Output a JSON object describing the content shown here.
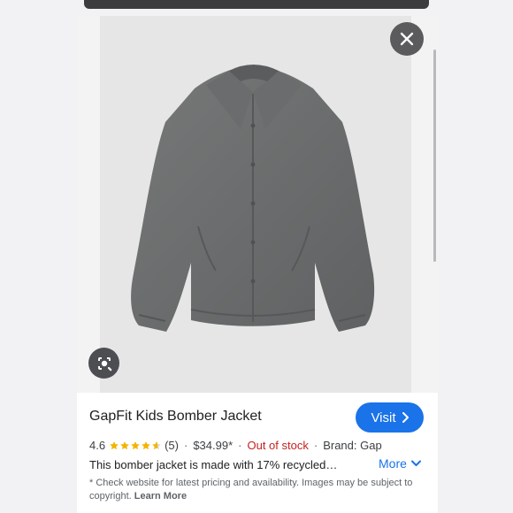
{
  "product": {
    "title": "GapFit Kids Bomber Jacket",
    "rating": "4.6",
    "stars": 4.6,
    "review_count": "(5)",
    "price": "$34.99*",
    "availability": "Out of stock",
    "brand": "Brand: Gap",
    "description": "This bomber jacket is made with 17% recycled…"
  },
  "actions": {
    "visit_label": "Visit",
    "more_label": "More"
  },
  "disclaimer": {
    "text": "* Check website for latest pricing and availability. Images may be subject to copyright.",
    "learn_more": "Learn More"
  },
  "icons": {
    "close": "close-icon",
    "lens": "lens-search-icon",
    "visit_arrow": "chevron-right-icon",
    "more_arrow": "chevron-down-icon",
    "star": "star-icon"
  },
  "colors": {
    "accent": "#1a73e8",
    "out_of_stock": "#c5221f",
    "star": "#f4b400",
    "jacket": "#6d6f70"
  },
  "separator": "·"
}
